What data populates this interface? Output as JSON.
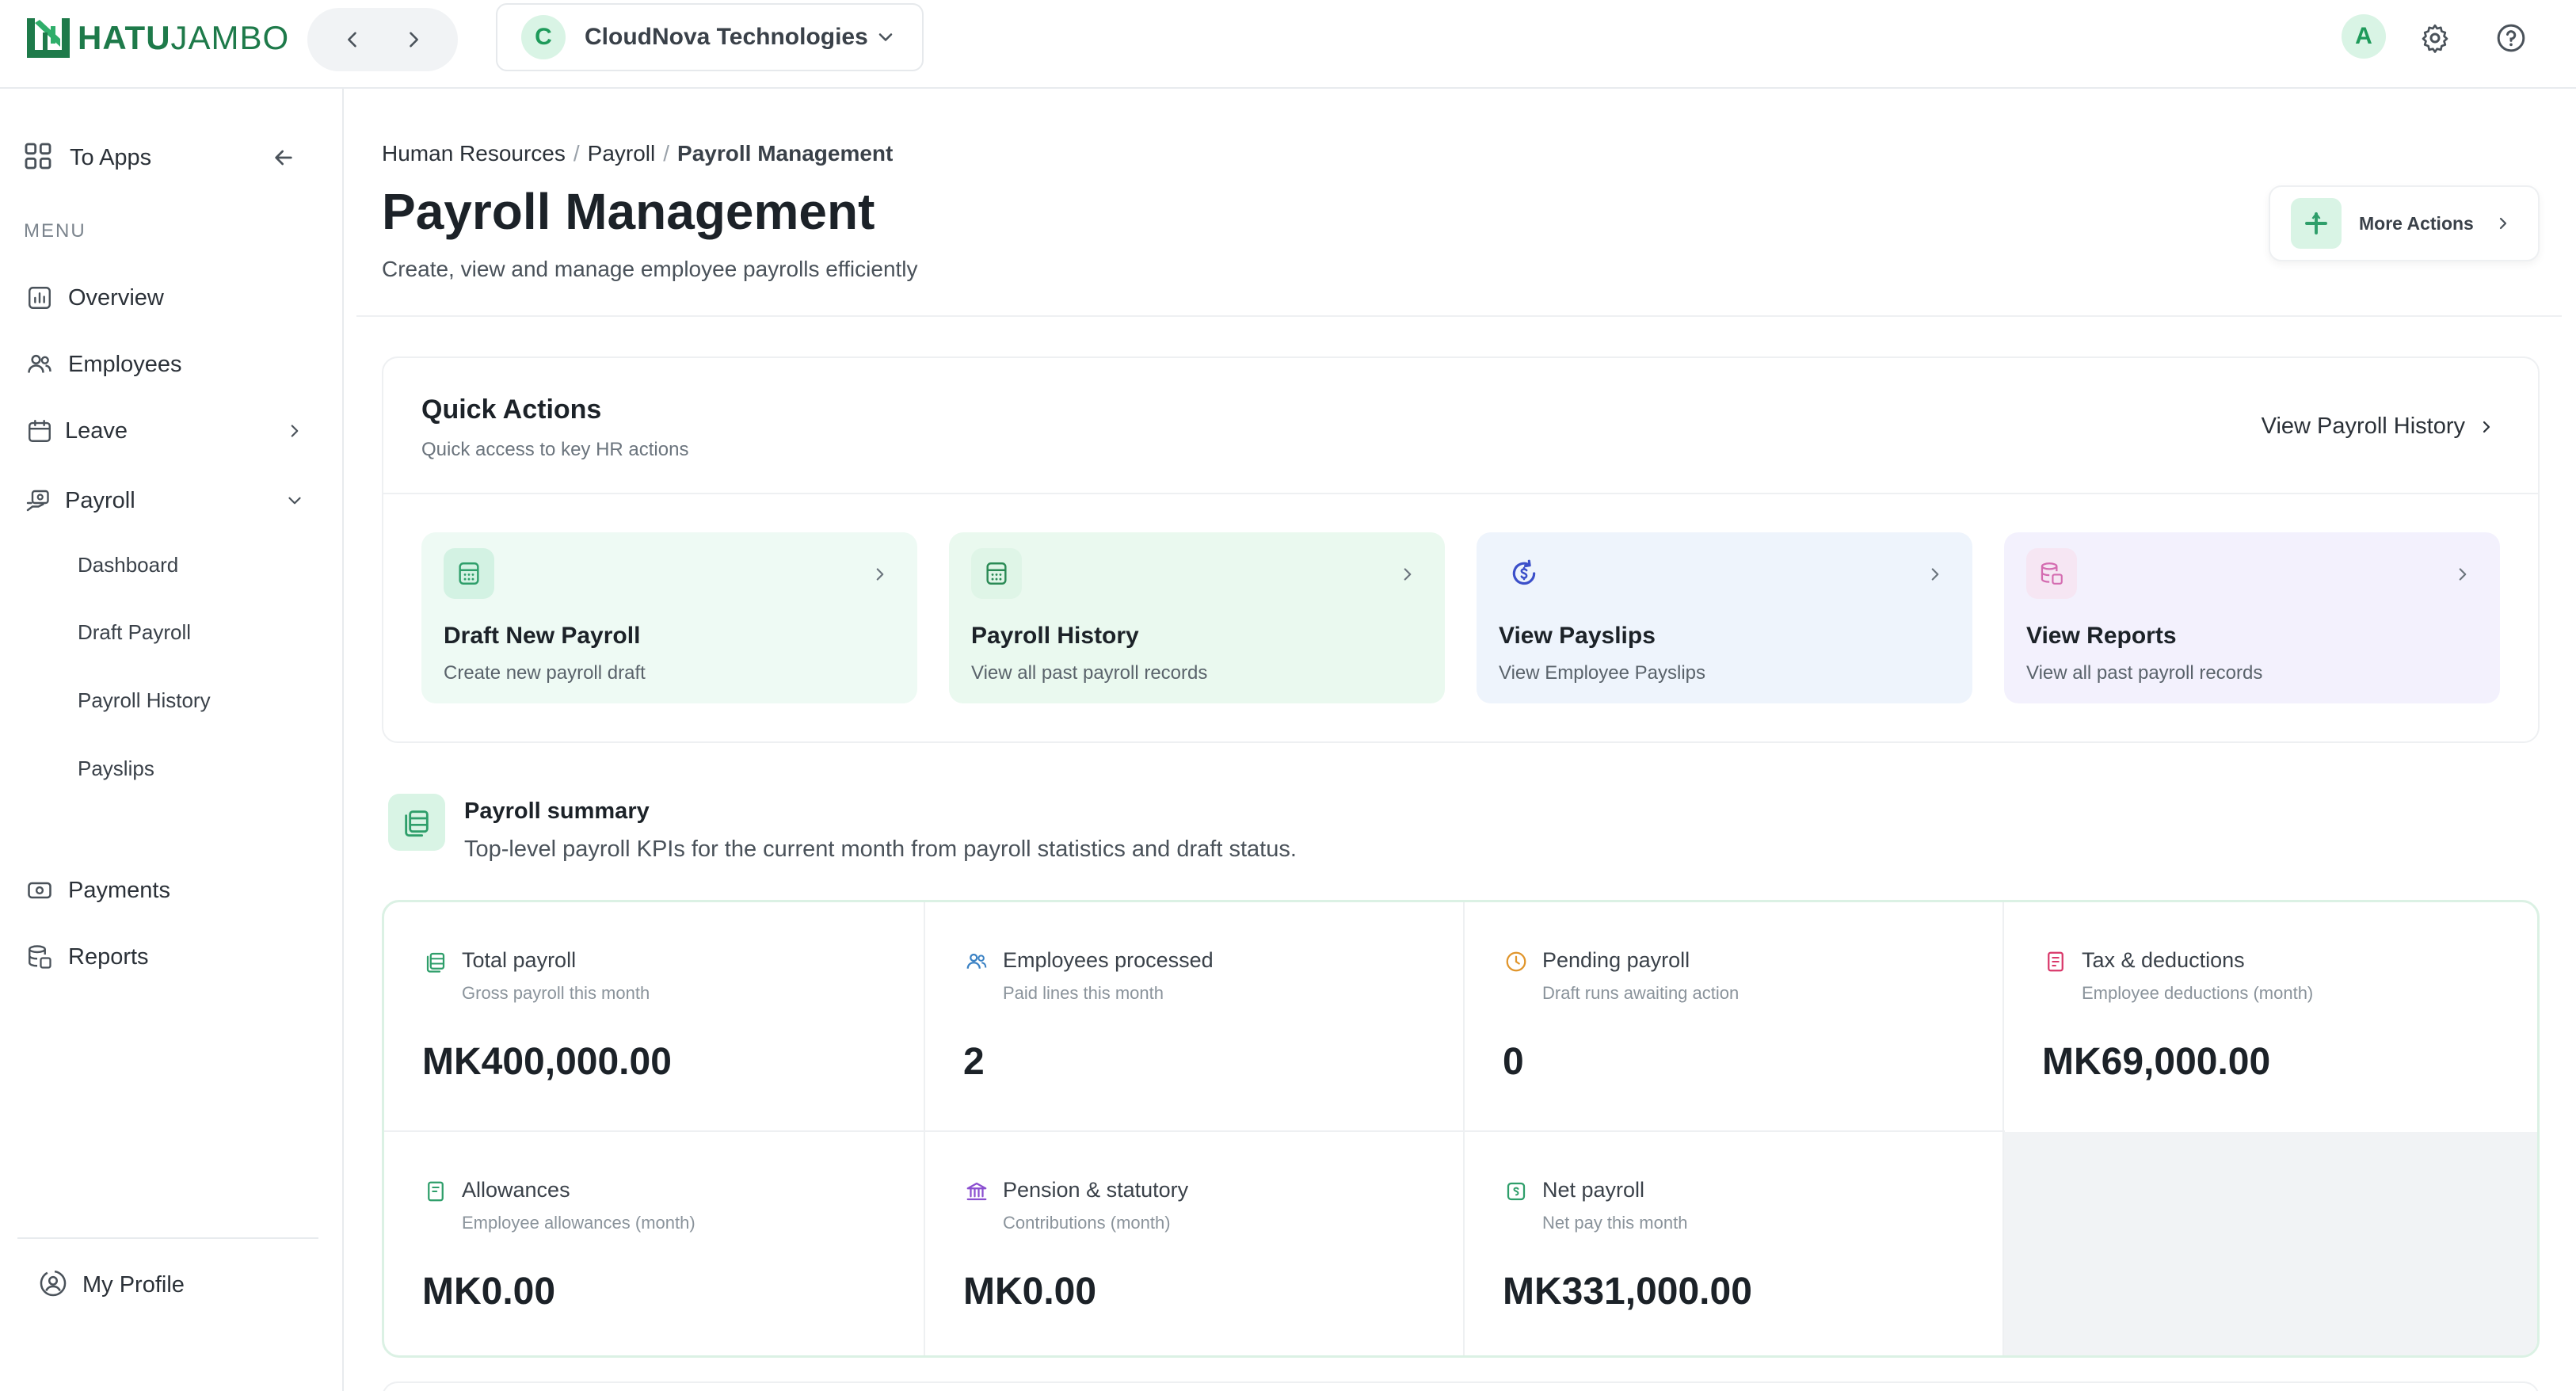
{
  "app": {
    "logo_text_bold": "HATU",
    "logo_text_light": "JAMBO",
    "brand_color": "#1e7a4a",
    "accent_color": "#d9f4e5"
  },
  "topbar": {
    "org_initial": "C",
    "org_name": "CloudNova Technologies",
    "user_initial": "A",
    "icons": [
      "arrow-left-icon",
      "arrow-right-icon",
      "chevron-down-icon",
      "gear-icon",
      "help-icon"
    ]
  },
  "sidebar": {
    "to_apps_label": "To Apps",
    "menu_heading": "MENU",
    "items": [
      {
        "label": "Overview",
        "icon": "chart-icon"
      },
      {
        "label": "Employees",
        "icon": "users-icon"
      },
      {
        "label": "Leave",
        "icon": "calendar-icon"
      },
      {
        "label": "Payroll",
        "icon": "payroll-icon"
      },
      {
        "label": "Payments",
        "icon": "payments-icon"
      },
      {
        "label": "Reports",
        "icon": "reports-icon"
      }
    ],
    "payroll_subitems": [
      "Dashboard",
      "Draft Payroll",
      "Payroll History",
      "Payslips"
    ],
    "profile_label": "My Profile"
  },
  "header": {
    "breadcrumb": [
      "Human Resources",
      "Payroll",
      "Payroll Management"
    ],
    "title": "Payroll Management",
    "subtitle": "Create, view and manage employee payrolls efficiently",
    "more_actions_label": "More Actions"
  },
  "quick_actions": {
    "title": "Quick Actions",
    "subtitle": "Quick access to key HR actions",
    "link_label": "View Payroll History",
    "tiles": [
      {
        "title": "Draft New Payroll",
        "subtitle": "Create new payroll draft",
        "bg": "#eefaf4",
        "icon_bg": "#d3f2e3",
        "icon_color": "#2e9e6a",
        "icon": "calculator-icon"
      },
      {
        "title": "Payroll History",
        "subtitle": "View all past payroll records",
        "bg": "#eaf9ef",
        "icon_bg": "#dff5e7",
        "icon_color": "#2a8a55",
        "icon": "calculator-icon"
      },
      {
        "title": "View Payslips",
        "subtitle": "View Employee Payslips",
        "bg": "#eef4fc",
        "icon_bg": "#eef4fc",
        "icon_color": "#3b4fc9",
        "icon": "dollar-refresh-icon"
      },
      {
        "title": "View Reports",
        "subtitle": "View all past payroll records",
        "bg": "#f3f1fd",
        "icon_bg": "#f6e6f3",
        "icon_color": "#d46bb0",
        "icon": "database-report-icon"
      }
    ]
  },
  "summary": {
    "title": "Payroll summary",
    "subtitle": "Top-level payroll KPIs for the current month from payroll statistics and draft status.",
    "kpis": [
      {
        "label": "Total payroll",
        "sub": "Gross payroll this month",
        "value": "MK400,000.00",
        "icon": "money-icon",
        "color": "#2e9e6a"
      },
      {
        "label": "Employees processed",
        "sub": "Paid lines this month",
        "value": "2",
        "icon": "users-icon",
        "color": "#3b82c4"
      },
      {
        "label": "Pending payroll",
        "sub": "Draft runs awaiting action",
        "value": "0",
        "icon": "clock-icon",
        "color": "#e0952b"
      },
      {
        "label": "Tax & deductions",
        "sub": "Employee deductions (month)",
        "value": "MK69,000.00",
        "icon": "receipt-icon",
        "color": "#d9386a"
      },
      {
        "label": "Allowances",
        "sub": "Employee allowances (month)",
        "value": "MK0.00",
        "icon": "document-icon",
        "color": "#2e9e6a"
      },
      {
        "label": "Pension & statutory",
        "sub": "Contributions (month)",
        "value": "MK0.00",
        "icon": "bank-icon",
        "color": "#8b4fd0"
      },
      {
        "label": "Net payroll",
        "sub": "Net pay this month",
        "value": "MK331,000.00",
        "icon": "net-pay-icon",
        "color": "#2e9e6a"
      }
    ]
  }
}
